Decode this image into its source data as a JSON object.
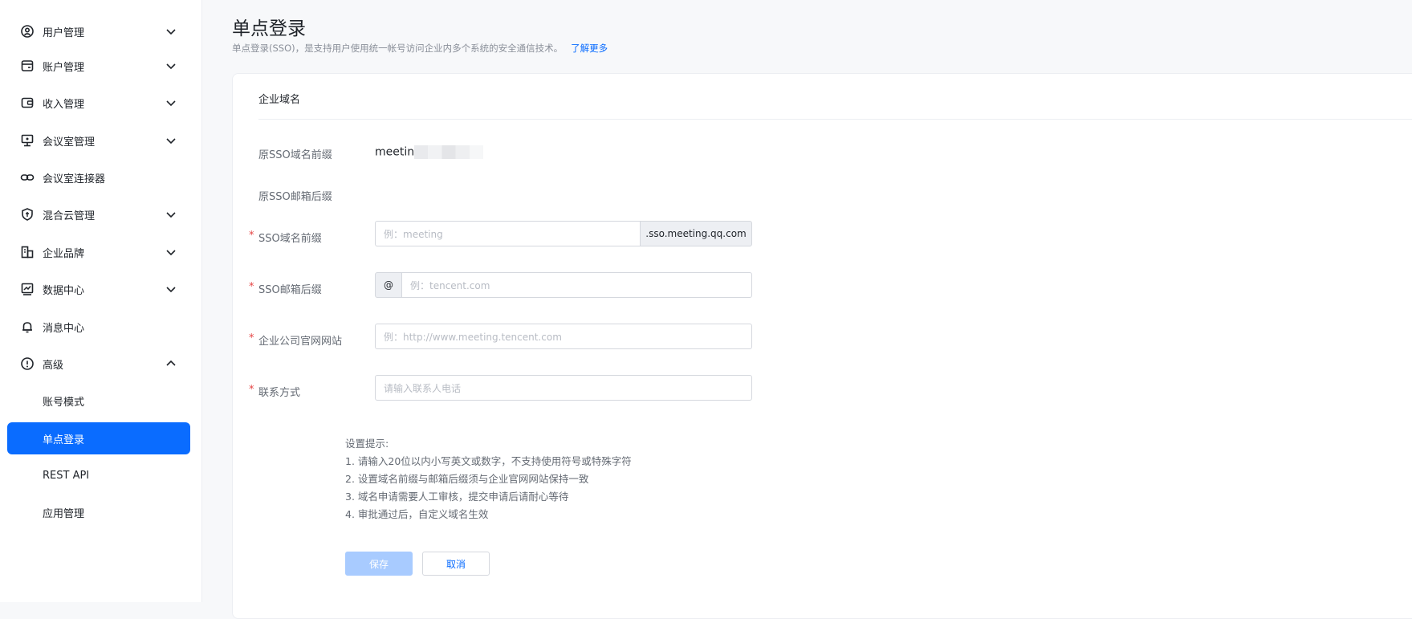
{
  "sidebar": {
    "items": [
      {
        "label": "用户管理",
        "icon": "user-circle-icon",
        "expandable": true,
        "expanded": false
      },
      {
        "label": "账户管理",
        "icon": "account-card-icon",
        "expandable": true,
        "expanded": false
      },
      {
        "label": "收入管理",
        "icon": "wallet-icon",
        "expandable": true,
        "expanded": false
      },
      {
        "label": "会议室管理",
        "icon": "meeting-room-icon",
        "expandable": true,
        "expanded": false
      },
      {
        "label": "会议室连接器",
        "icon": "link-icon",
        "expandable": false
      },
      {
        "label": "混合云管理",
        "icon": "shield-icon",
        "expandable": true,
        "expanded": false
      },
      {
        "label": "企业品牌",
        "icon": "building-icon",
        "expandable": true,
        "expanded": false
      },
      {
        "label": "数据中心",
        "icon": "chart-icon",
        "expandable": true,
        "expanded": false
      },
      {
        "label": "消息中心",
        "icon": "bell-icon",
        "expandable": false
      },
      {
        "label": "高级",
        "icon": "info-circle-icon",
        "expandable": true,
        "expanded": true
      }
    ],
    "sub_items": [
      {
        "label": "账号模式",
        "active": false
      },
      {
        "label": "单点登录",
        "active": true
      },
      {
        "label": "REST API",
        "active": false
      },
      {
        "label": "应用管理",
        "active": false
      }
    ]
  },
  "page": {
    "title": "单点登录",
    "description": "单点登录(SSO)，是支持用户使用统一帐号访问企业内多个系统的安全通信技术。",
    "learn_more": "了解更多"
  },
  "card": {
    "title": "企业域名",
    "original_prefix_label": "原SSO域名前缀",
    "original_prefix_value": "meetin",
    "original_suffix_label": "原SSO邮箱后缀",
    "domain_prefix_label": "SSO域名前缀",
    "domain_prefix_placeholder": "例：meeting",
    "domain_suffix_addon": ".sso.meeting.qq.com",
    "email_suffix_label": "SSO邮箱后缀",
    "email_prefix_addon": "@",
    "email_suffix_placeholder": "例：tencent.com",
    "website_label": "企业公司官网网站",
    "website_placeholder": "例：http://www.meeting.tencent.com",
    "contact_label": "联系方式",
    "contact_placeholder": "请输入联系人电话",
    "required_mark": "*"
  },
  "tips": {
    "title": "设置提示:",
    "lines": [
      "1. 请输入20位以内小写英文或数字，不支持使用符号或特殊字符",
      "2. 设置域名前缀与邮箱后缀须与企业官网网站保持一致",
      "3. 域名申请需要人工审核，提交申请后请耐心等待",
      "4. 审批通过后，自定义域名生效"
    ]
  },
  "actions": {
    "save_label": "保存",
    "cancel_label": "取消"
  },
  "colors": {
    "accent": "#0a6cff",
    "required": "#e54545",
    "save_disabled": "#a8cbff"
  }
}
